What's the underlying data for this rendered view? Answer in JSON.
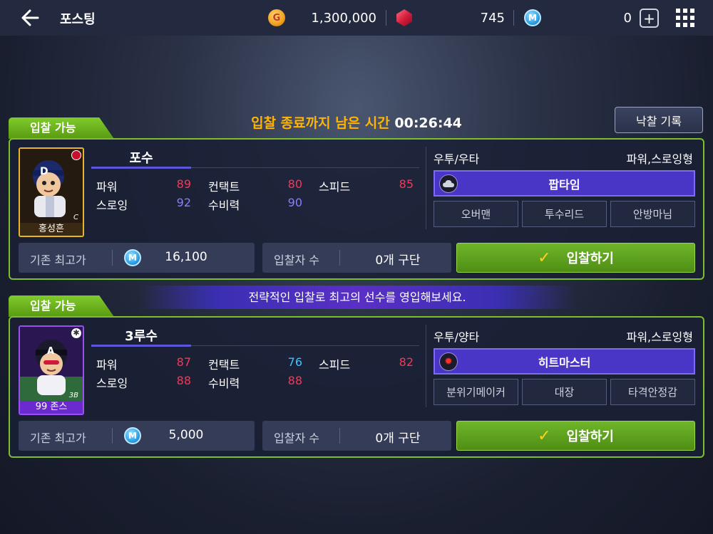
{
  "header": {
    "title": "포스팅",
    "gold": "1,300,000",
    "gems": "745",
    "mileage": "0"
  },
  "auction": {
    "timer_label": "입찰 종료까지 남은 시간",
    "timer_value": "00:26:44",
    "history_button": "낙찰 기록"
  },
  "banner": "전략적인 입찰로 최고의 선수를 영입해보세요.",
  "players": [
    {
      "tab": "입찰 가능",
      "name": "홍성흔",
      "card_badge": "C",
      "position": "포수",
      "stats": [
        {
          "label": "파워",
          "value": "89",
          "color": "#ff3355"
        },
        {
          "label": "컨택트",
          "value": "80",
          "color": "#ff3355"
        },
        {
          "label": "스피드",
          "value": "85",
          "color": "#ff3355"
        },
        {
          "label": "스로잉",
          "value": "92",
          "color": "#8d7cff"
        },
        {
          "label": "수비력",
          "value": "90",
          "color": "#8d7cff"
        }
      ],
      "hand": "우투/우타",
      "type": "파워,스로잉형",
      "main_skill": "팝타임",
      "main_skill_icon": "cloud-icon",
      "sub_skills": [
        "오버맨",
        "투수리드",
        "안방마님"
      ],
      "base_price_label": "기존 최고가",
      "base_price": "16,100",
      "bidders_label": "입찰자 수",
      "bidders": "0개 구단",
      "bid_button": "입찰하기"
    },
    {
      "tab": "입찰 가능",
      "name": "99 존스",
      "card_badge": "3B",
      "position": "3루수",
      "stats": [
        {
          "label": "파워",
          "value": "87",
          "color": "#ff3355"
        },
        {
          "label": "컨택트",
          "value": "76",
          "color": "#3ec4ff"
        },
        {
          "label": "스피드",
          "value": "82",
          "color": "#ff3355"
        },
        {
          "label": "스로잉",
          "value": "88",
          "color": "#ff3355"
        },
        {
          "label": "수비력",
          "value": "88",
          "color": "#ff3355"
        }
      ],
      "hand": "우투/양타",
      "type": "파워,스로잉형",
      "main_skill": "히트마스터",
      "main_skill_icon": "sun-icon",
      "sub_skills": [
        "분위기메이커",
        "대장",
        "타격안정감"
      ],
      "base_price_label": "기존 최고가",
      "base_price": "5,000",
      "bidders_label": "입찰자 수",
      "bidders": "0개 구단",
      "bid_button": "입찰하기"
    }
  ]
}
